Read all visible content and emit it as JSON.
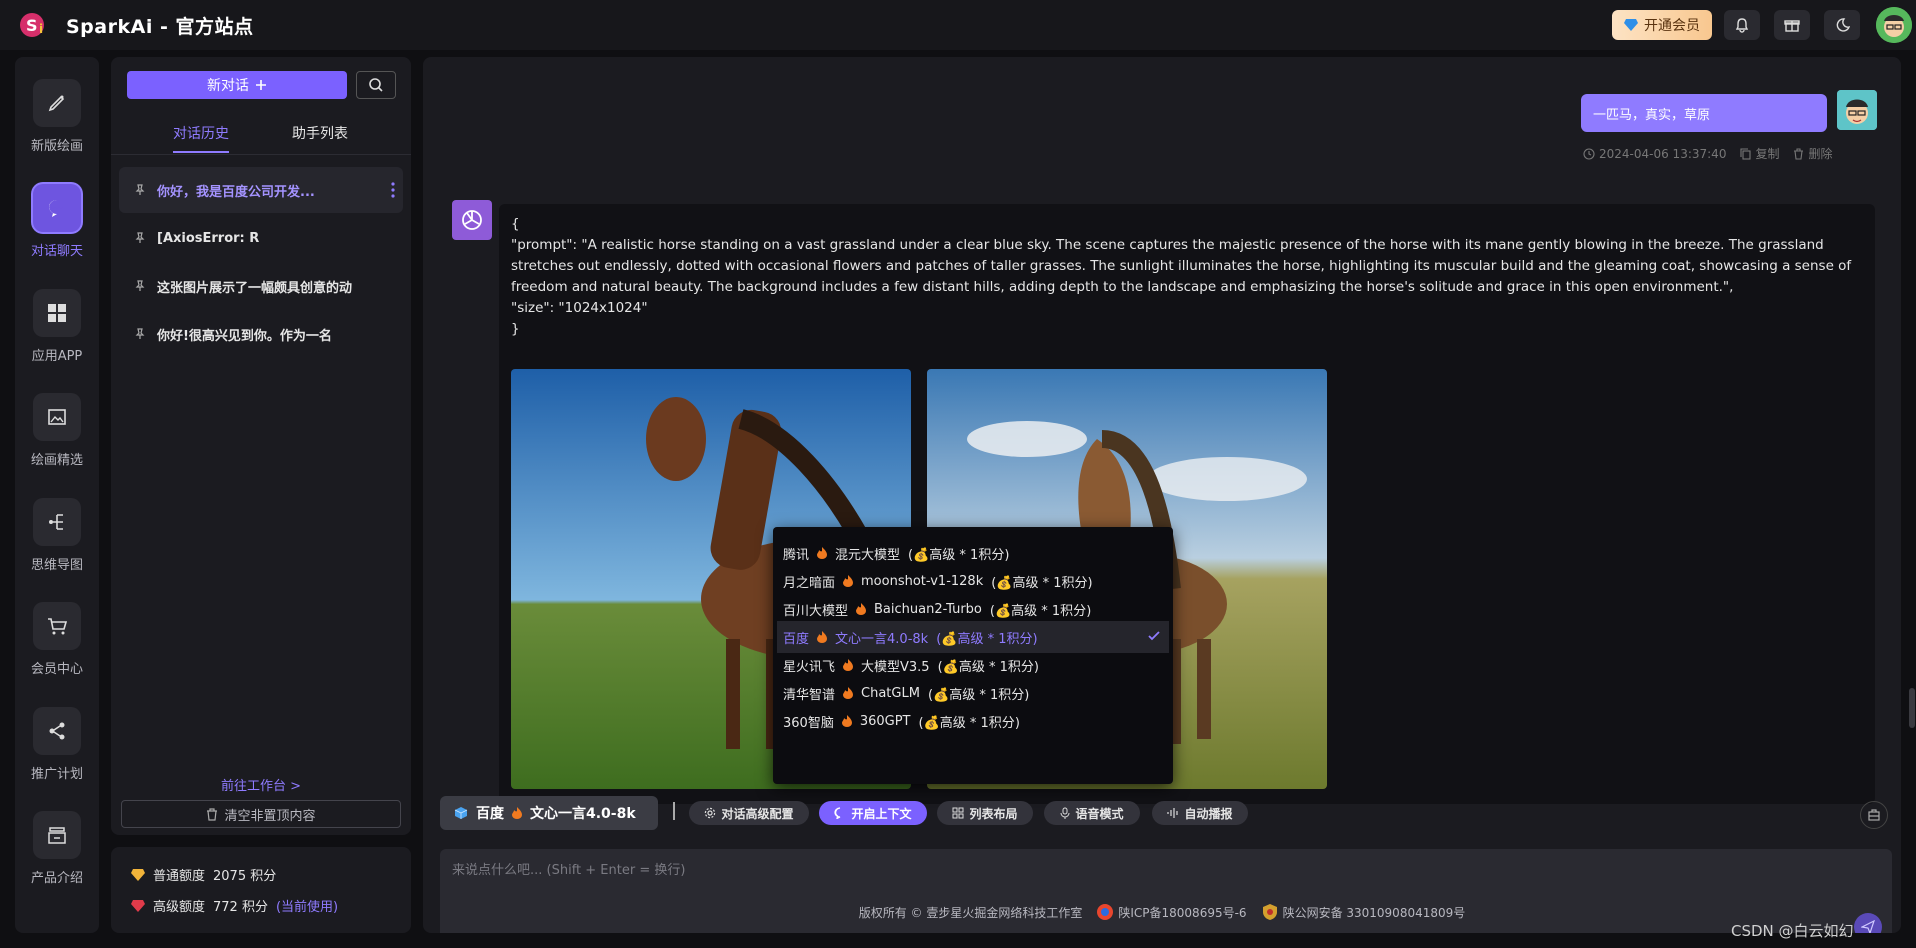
{
  "app": {
    "title": "SparkAi - 官方站点",
    "vip_label": "开通会员"
  },
  "nav": [
    {
      "label": "新版绘画",
      "icon": "pen-icon"
    },
    {
      "label": "对话聊天",
      "icon": "chat-icon",
      "active": true
    },
    {
      "label": "应用APP",
      "icon": "grid-icon"
    },
    {
      "label": "绘画精选",
      "icon": "gallery-icon"
    },
    {
      "label": "思维导图",
      "icon": "mindmap-icon"
    },
    {
      "label": "会员中心",
      "icon": "cart-icon"
    },
    {
      "label": "推广计划",
      "icon": "share-icon"
    },
    {
      "label": "产品介绍",
      "icon": "product-icon"
    }
  ],
  "history": {
    "new_chat": "新对话",
    "tabs": {
      "history": "对话历史",
      "assistants": "助手列表"
    },
    "items": [
      {
        "text": "你好，我是百度公司开发..."
      },
      {
        "text": "[AxiosError: R"
      },
      {
        "text": "这张图片展示了一幅颇具创意的动"
      },
      {
        "text": "你好!很高兴见到你。作为一名"
      }
    ],
    "goto_workspace": "前往工作台 >",
    "clear_btn": "清空非置顶内容"
  },
  "quota": {
    "normal_label": "普通额度",
    "normal_value": "2075 积分",
    "advanced_label": "高级额度",
    "advanced_value": "772 积分",
    "current": "(当前使用)"
  },
  "chat": {
    "user_message": "一匹马，真实，草原",
    "user_time": "2024-04-06 13:37:40",
    "copy_label": "复制",
    "delete_label": "删除",
    "bot_text": "{\n\"prompt\": \"A realistic horse standing on a vast grassland under a clear blue sky. The scene captures the majestic presence of the horse with its mane gently blowing in the breeze. The grassland stretches out endlessly, dotted with occasional flowers and patches of taller grasses. The sunlight illuminates the horse, highlighting its muscular build and the gleaming coat, showcasing a sense of freedom and natural beauty. The background includes a few distant hills, adding depth to the landscape and emphasizing the horse's solitude and grace in this open environment.\",\n\"size\": \"1024x1024\"\n}"
  },
  "models": [
    {
      "provider": "腾讯",
      "name": "混元大模型",
      "level": "高级 * 1积分"
    },
    {
      "provider": "月之暗面",
      "name": "moonshot-v1-128k",
      "level": "高级 * 1积分"
    },
    {
      "provider": "百川大模型",
      "name": "Baichuan2-Turbo",
      "level": "高级 * 1积分"
    },
    {
      "provider": "百度",
      "name": "文心一言4.0-8k",
      "level": "高级 * 1积分",
      "selected": true
    },
    {
      "provider": "星火讯飞",
      "name": "大模型V3.5",
      "level": "高级 * 1积分"
    },
    {
      "provider": "清华智谱",
      "name": "ChatGLM",
      "level": "高级 * 1积分"
    },
    {
      "provider": "360智脑",
      "name": "360GPT",
      "level": "高级 * 1积分"
    }
  ],
  "toolbar": {
    "current_provider": "百度",
    "current_model": "文心一言4.0-8k",
    "buttons": [
      {
        "label": "对话高级配置",
        "icon": "gear-icon"
      },
      {
        "label": "开启上下文",
        "icon": "chat-bubble-icon",
        "on": true
      },
      {
        "label": "列表布局",
        "icon": "grid-small-icon"
      },
      {
        "label": "语音模式",
        "icon": "mic-icon"
      },
      {
        "label": "自动播报",
        "icon": "wave-icon"
      }
    ]
  },
  "input": {
    "placeholder": "来说点什么吧... (Shift + Enter = 换行)"
  },
  "footer": {
    "copyright": "版权所有 © 壹步星火掘金网络科技工作室",
    "icp": "陕ICP备18008695号-6",
    "police": "陕公网安备 33010908041809号"
  },
  "watermark": "CSDN @白云如幻",
  "colors": {
    "accent": "#7b61ff",
    "bg": "#0f0f12",
    "panel": "#1b1b20"
  }
}
